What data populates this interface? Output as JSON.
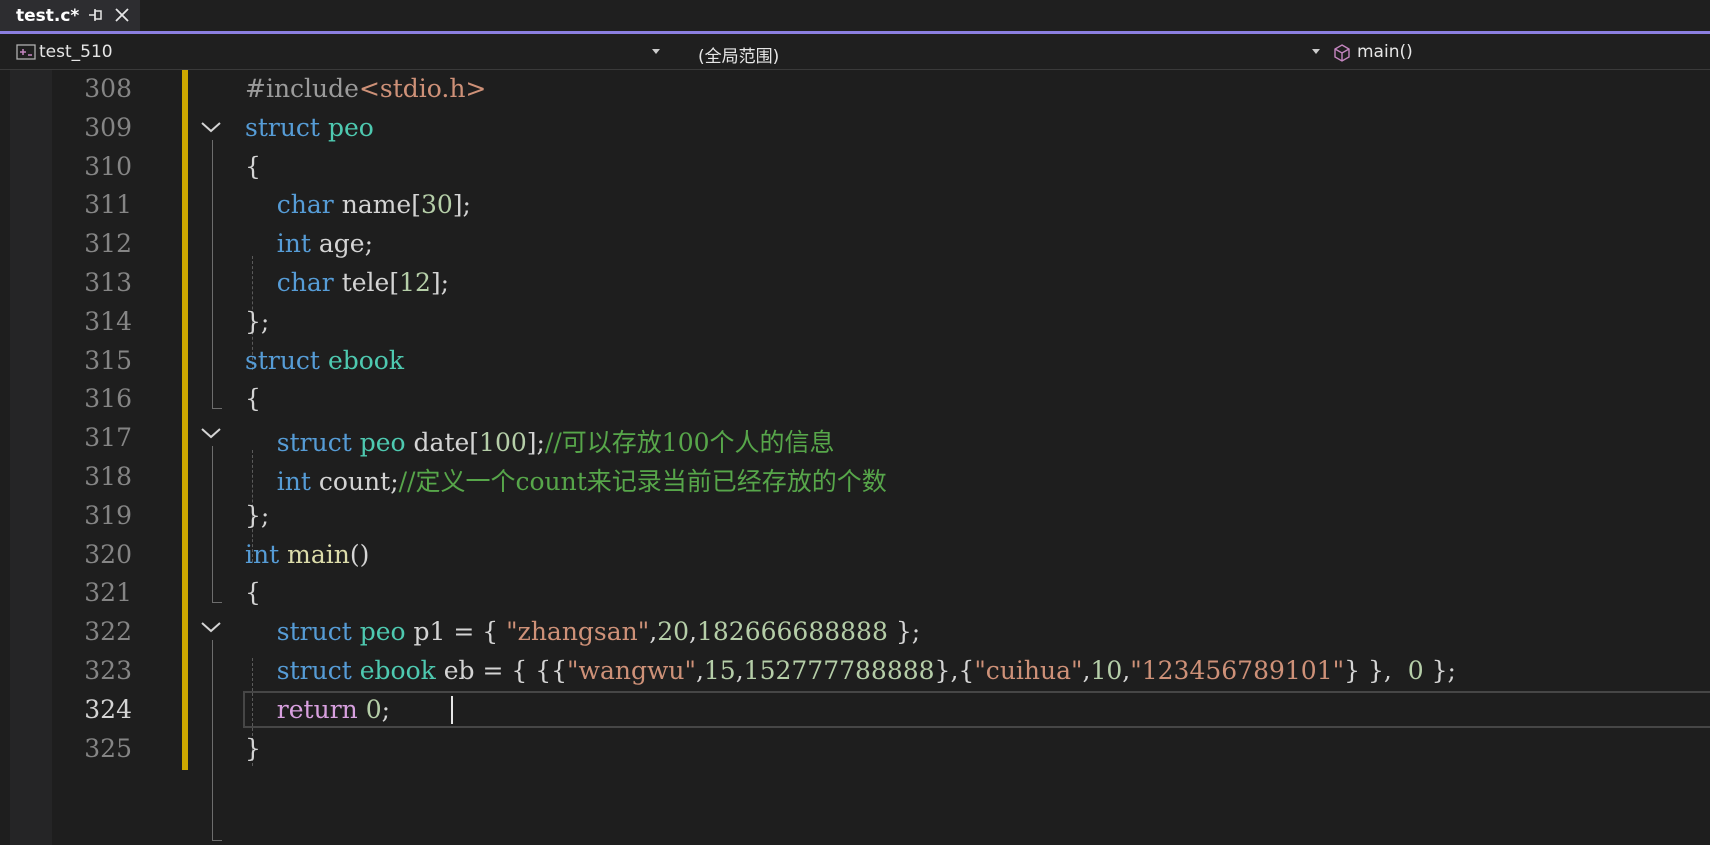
{
  "tab": {
    "title": "test.c*"
  },
  "navbar": {
    "project": "test_510",
    "scope": "(全局范围)",
    "function": "main()"
  },
  "editor": {
    "current_line": "324",
    "lines": [
      {
        "num": "308",
        "segments": [
          {
            "t": "#include",
            "c": "pp"
          },
          {
            "t": "<stdio.h>",
            "c": "str"
          }
        ]
      },
      {
        "num": "309",
        "segments": [
          {
            "t": "struct",
            "c": "kw"
          },
          {
            "t": " "
          },
          {
            "t": "peo",
            "c": "ty"
          }
        ]
      },
      {
        "num": "310",
        "segments": [
          {
            "t": "{"
          }
        ]
      },
      {
        "num": "311",
        "segments": [
          {
            "t": "    "
          },
          {
            "t": "char",
            "c": "kw"
          },
          {
            "t": " name["
          },
          {
            "t": "30",
            "c": "num"
          },
          {
            "t": "];"
          }
        ]
      },
      {
        "num": "312",
        "segments": [
          {
            "t": "    "
          },
          {
            "t": "int",
            "c": "kw"
          },
          {
            "t": " age;"
          }
        ]
      },
      {
        "num": "313",
        "segments": [
          {
            "t": "    "
          },
          {
            "t": "char",
            "c": "kw"
          },
          {
            "t": " tele["
          },
          {
            "t": "12",
            "c": "num"
          },
          {
            "t": "];"
          }
        ]
      },
      {
        "num": "314",
        "segments": [
          {
            "t": "};"
          }
        ]
      },
      {
        "num": "315",
        "segments": [
          {
            "t": "struct",
            "c": "kw"
          },
          {
            "t": " "
          },
          {
            "t": "ebook",
            "c": "ty"
          }
        ]
      },
      {
        "num": "316",
        "segments": [
          {
            "t": "{"
          }
        ]
      },
      {
        "num": "317",
        "segments": [
          {
            "t": "    "
          },
          {
            "t": "struct",
            "c": "kw"
          },
          {
            "t": " "
          },
          {
            "t": "peo",
            "c": "ty"
          },
          {
            "t": " date["
          },
          {
            "t": "100",
            "c": "num"
          },
          {
            "t": "];"
          },
          {
            "t": "//可以存放100个人的信息",
            "c": "cmt"
          }
        ]
      },
      {
        "num": "318",
        "segments": [
          {
            "t": "    "
          },
          {
            "t": "int",
            "c": "kw"
          },
          {
            "t": " count;"
          },
          {
            "t": "//定义一个count来记录当前已经存放的个数",
            "c": "cmt"
          }
        ]
      },
      {
        "num": "319",
        "segments": [
          {
            "t": "};"
          }
        ]
      },
      {
        "num": "320",
        "segments": [
          {
            "t": "int",
            "c": "kw"
          },
          {
            "t": " "
          },
          {
            "t": "main",
            "c": "fn"
          },
          {
            "t": "()"
          }
        ]
      },
      {
        "num": "321",
        "segments": [
          {
            "t": "{"
          }
        ]
      },
      {
        "num": "322",
        "segments": [
          {
            "t": "    "
          },
          {
            "t": "struct",
            "c": "kw"
          },
          {
            "t": " "
          },
          {
            "t": "peo",
            "c": "ty"
          },
          {
            "t": " p1 = { "
          },
          {
            "t": "\"zhangsan\"",
            "c": "str"
          },
          {
            "t": ","
          },
          {
            "t": "20",
            "c": "num"
          },
          {
            "t": ","
          },
          {
            "t": "182666688888",
            "c": "num"
          },
          {
            "t": " };"
          }
        ]
      },
      {
        "num": "323",
        "segments": [
          {
            "t": "    "
          },
          {
            "t": "struct",
            "c": "kw"
          },
          {
            "t": " "
          },
          {
            "t": "ebook",
            "c": "ty"
          },
          {
            "t": " eb = { {{"
          },
          {
            "t": "\"wangwu\"",
            "c": "str"
          },
          {
            "t": ","
          },
          {
            "t": "15",
            "c": "num"
          },
          {
            "t": ","
          },
          {
            "t": "152777788888",
            "c": "num"
          },
          {
            "t": "},{"
          },
          {
            "t": "\"cuihua\"",
            "c": "str"
          },
          {
            "t": ","
          },
          {
            "t": "10",
            "c": "num"
          },
          {
            "t": ","
          },
          {
            "t": "\"123456789101\"",
            "c": "str"
          },
          {
            "t": "} },  "
          },
          {
            "t": "0",
            "c": "num"
          },
          {
            "t": " };"
          }
        ]
      },
      {
        "num": "324",
        "segments": [
          {
            "t": "    "
          },
          {
            "t": "return",
            "c": "ctl"
          },
          {
            "t": " "
          },
          {
            "t": "0",
            "c": "num"
          },
          {
            "t": ";"
          }
        ]
      },
      {
        "num": "325",
        "segments": [
          {
            "t": "}"
          }
        ]
      }
    ]
  }
}
